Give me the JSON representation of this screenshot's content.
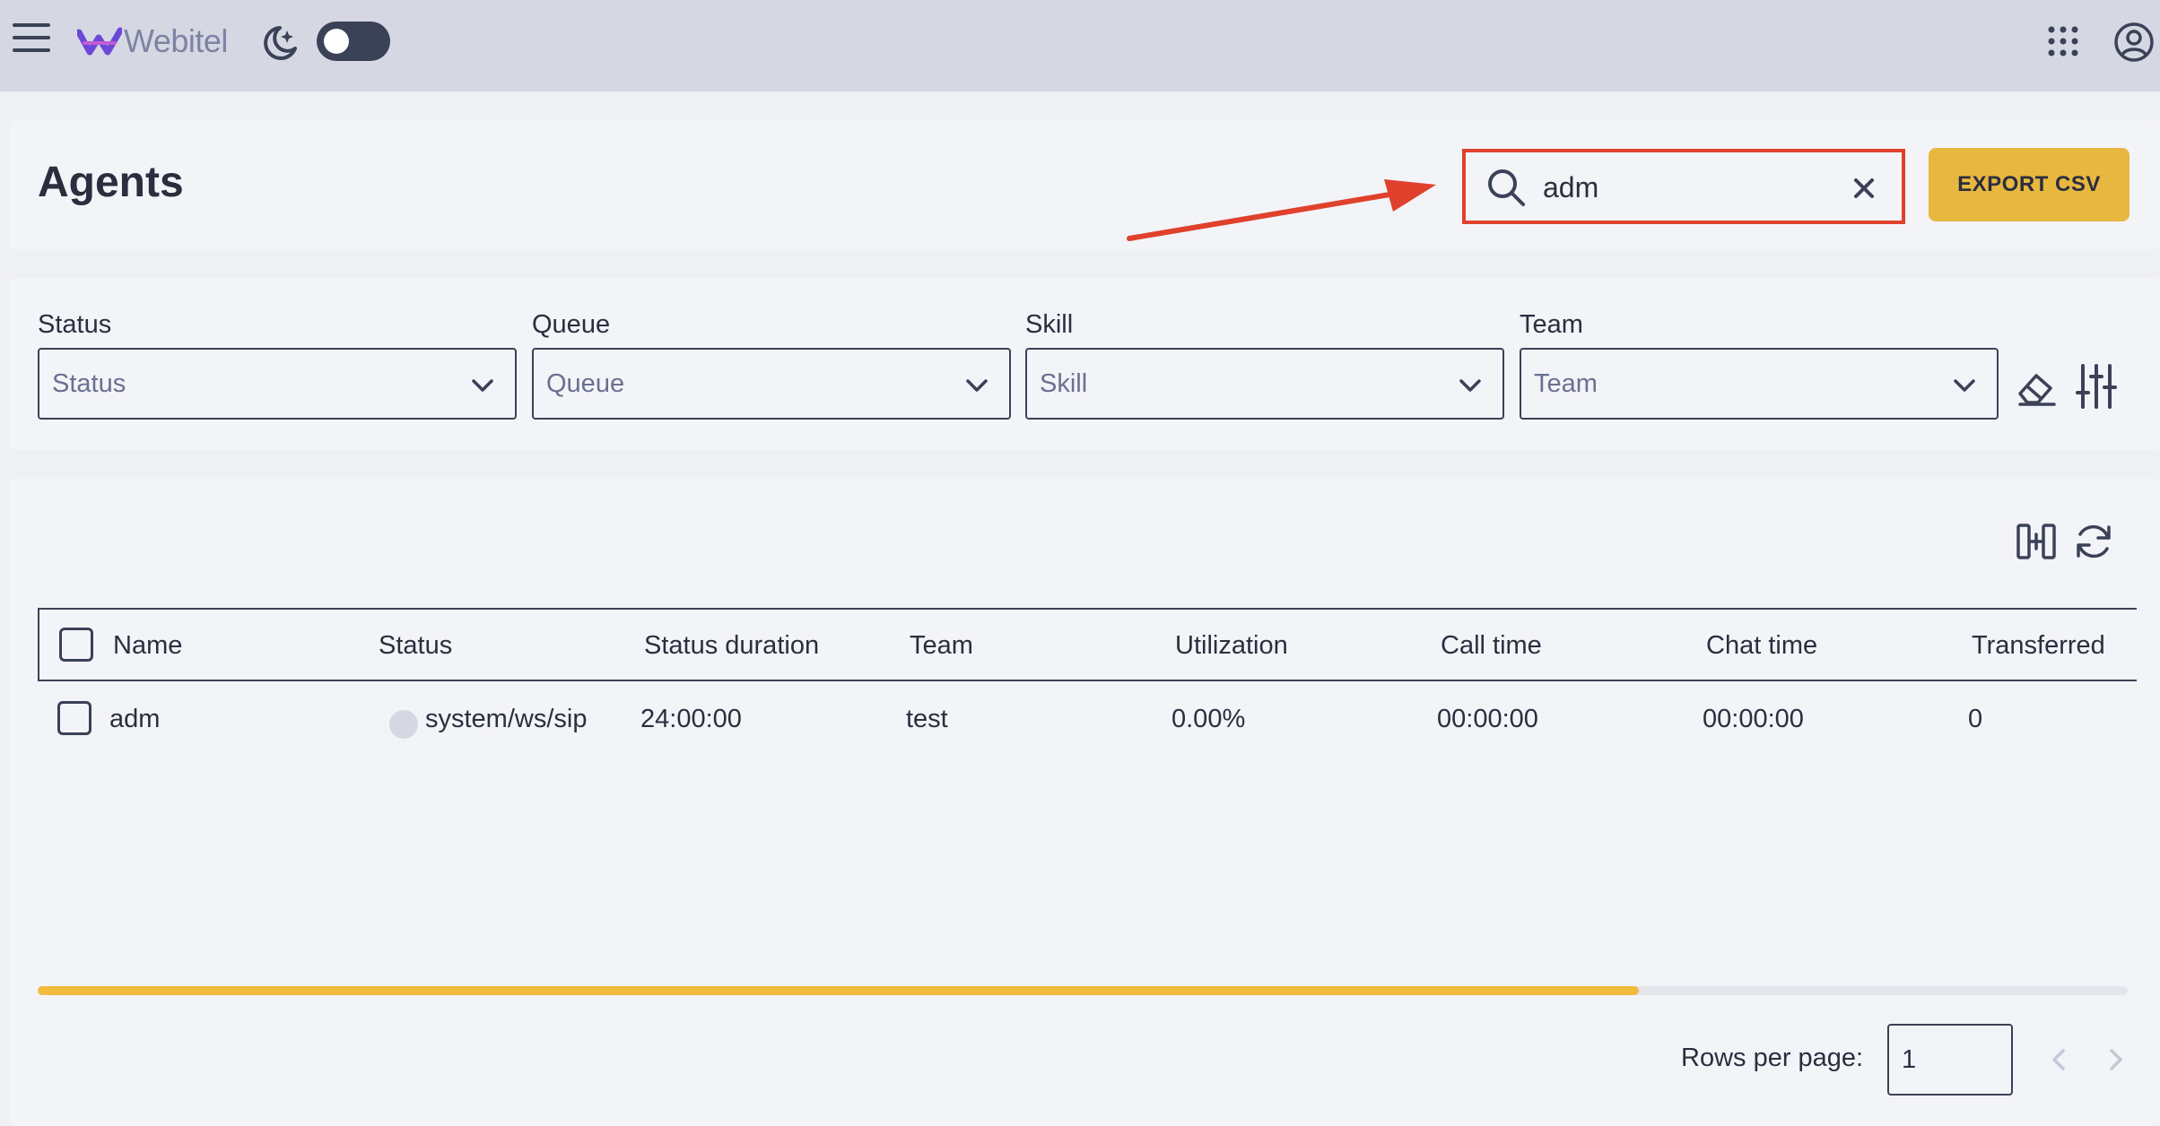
{
  "app": {
    "name": "Webitel"
  },
  "header": {
    "title": "Agents",
    "search": {
      "value": "adm",
      "placeholder": ""
    },
    "export_label": "EXPORT CSV"
  },
  "filters": [
    {
      "label": "Status",
      "placeholder": "Status"
    },
    {
      "label": "Queue",
      "placeholder": "Queue"
    },
    {
      "label": "Skill",
      "placeholder": "Skill"
    },
    {
      "label": "Team",
      "placeholder": "Team"
    }
  ],
  "table": {
    "columns": [
      "Name",
      "Status",
      "Status duration",
      "Team",
      "Utilization",
      "Call time",
      "Chat time",
      "Transferred"
    ],
    "rows": [
      {
        "name": "adm",
        "status": "system/ws/sip",
        "status_duration": "24:00:00",
        "team": "test",
        "utilization": "0.00%",
        "call_time": "00:00:00",
        "chat_time": "00:00:00",
        "transferred": "0"
      }
    ],
    "horizontal_scroll_fraction": 0.766
  },
  "pagination": {
    "rows_per_page_label": "Rows per page:",
    "rows_per_page_value": "1"
  },
  "colors": {
    "topbar": "#d5d8e3",
    "accent": "#e8b73f",
    "annotation": "#e0412d",
    "text": "#2b2e3e"
  },
  "icons": [
    "menu-icon",
    "webitel-logo",
    "moon-icon",
    "apps-grid-icon",
    "account-icon",
    "search-icon",
    "close-icon",
    "chevron-down-icon",
    "eraser-icon",
    "filter-settings-icon",
    "columns-icon",
    "refresh-icon",
    "chevron-left-icon",
    "chevron-right-icon"
  ]
}
